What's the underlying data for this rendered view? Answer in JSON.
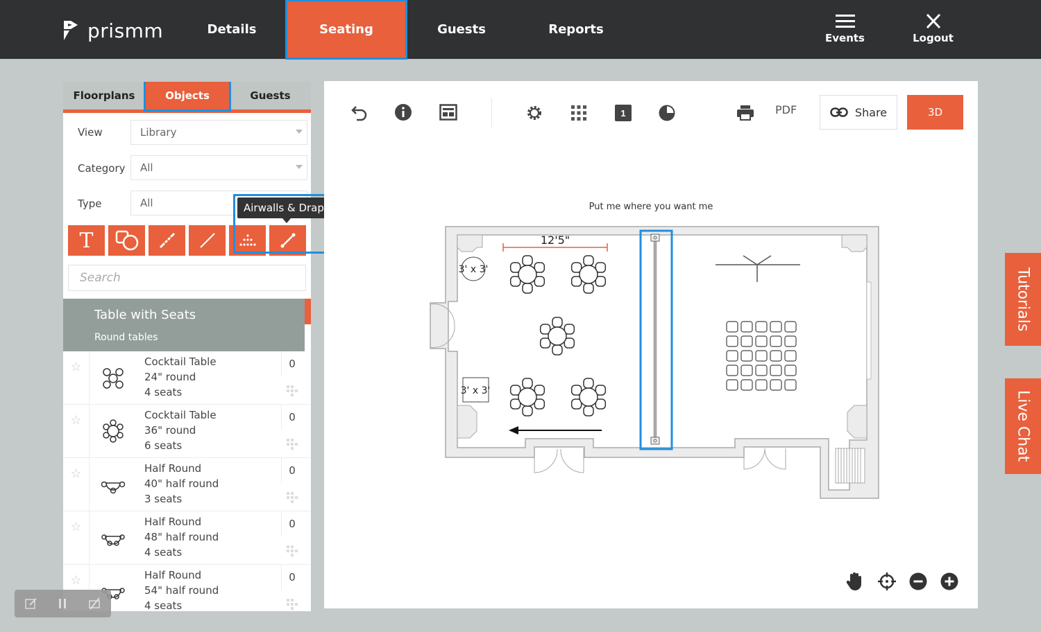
{
  "header": {
    "brand": "prismm",
    "nav": [
      {
        "label": "Details"
      },
      {
        "label": "Seating"
      },
      {
        "label": "Guests"
      },
      {
        "label": "Reports"
      }
    ],
    "events_label": "Events",
    "logout_label": "Logout"
  },
  "sidebar": {
    "tabs": [
      {
        "label": "Floorplans"
      },
      {
        "label": "Objects"
      },
      {
        "label": "Guests"
      }
    ],
    "filters": [
      {
        "label": "View",
        "value": "Library"
      },
      {
        "label": "Category",
        "value": "All"
      },
      {
        "label": "Type",
        "value": "All"
      }
    ],
    "tools": [
      {
        "icon": "text-tool-icon"
      },
      {
        "icon": "shapes-tool-icon"
      },
      {
        "icon": "measure-tool-icon"
      },
      {
        "icon": "line-tool-icon"
      },
      {
        "icon": "grid-dots-tool-icon"
      },
      {
        "icon": "airwall-tool-icon"
      }
    ],
    "tooltip": "Airwalls & Draping",
    "search_placeholder": "Search",
    "category": {
      "title": "Table with Seats",
      "subtitle": "Round tables"
    },
    "items": [
      {
        "name": "Cocktail Table",
        "size": "24\" round",
        "seats": "4 seats",
        "count": "0"
      },
      {
        "name": "Cocktail Table",
        "size": "36\" round",
        "seats": "6 seats",
        "count": "0"
      },
      {
        "name": "Half Round",
        "size": "40\" half round",
        "seats": "3 seats",
        "count": "0"
      },
      {
        "name": "Half Round",
        "size": "48\" half round",
        "seats": "4 seats",
        "count": "0"
      },
      {
        "name": "Half Round",
        "size": "54\" half round",
        "seats": "4 seats",
        "count": "0"
      }
    ]
  },
  "canvas": {
    "share_label": "Share",
    "pdf_label": "PDF",
    "btn_3d": "3D",
    "layer_number": "1",
    "hint": "Put me where you want me",
    "dimension": "12'5\"",
    "table_label_1": "3' x 3'",
    "table_label_2": "3' x 3'"
  },
  "sidetabs": {
    "tutorials": "Tutorials",
    "live_chat": "Live Chat"
  },
  "colors": {
    "accent": "#e8603c",
    "header": "#2f3133",
    "highlight": "#1f8fe0"
  }
}
